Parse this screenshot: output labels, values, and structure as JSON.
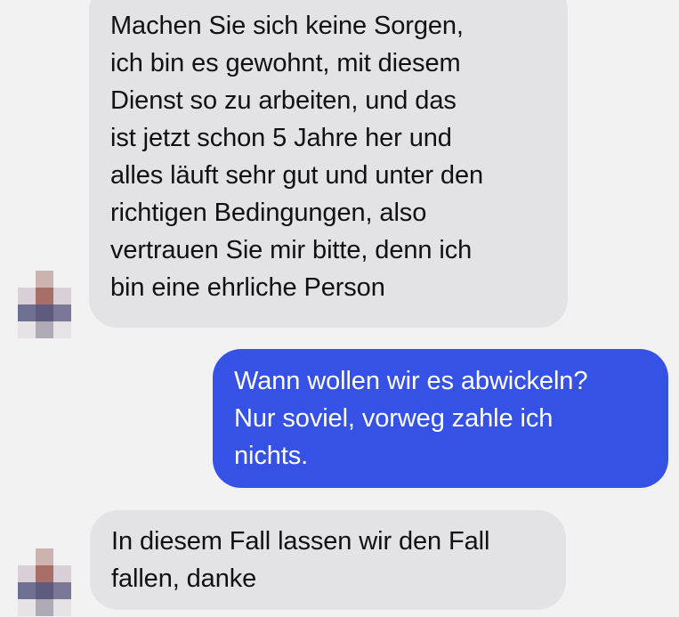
{
  "conversation": {
    "messages": [
      {
        "sender": "contact",
        "text": "Machen Sie sich keine Sorgen,\nich bin es gewohnt, mit diesem\nDienst so zu arbeiten, und das\nist jetzt schon 5 Jahre her und\nalles läuft sehr gut und unter den\nrichtigen Bedingungen, also\nvertrauen Sie mir bitte, denn ich\nbin eine ehrliche Person"
      },
      {
        "sender": "me",
        "text": "Wann wollen wir es abwickeln?\nNur soviel, vorweg zahle ich\nnichts."
      },
      {
        "sender": "contact",
        "text": "In diesem Fall lassen wir den Fall\nfallen, danke"
      }
    ]
  },
  "colors": {
    "background": "#f2f2f2",
    "incoming_bubble": "#e3e3e6",
    "outgoing_bubble": "#3652e6",
    "outgoing_text": "#ffffff"
  },
  "avatar": {
    "icon": "pixelated-avatar-icon"
  }
}
